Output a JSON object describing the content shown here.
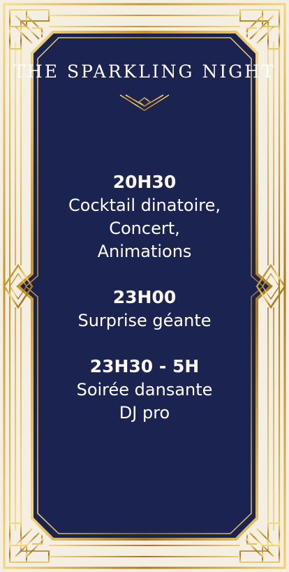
{
  "poster": {
    "title": "THE SPARKLING NIGHT",
    "colors": {
      "navy": "#1b2451",
      "gold": "#d4a93b",
      "gold_light": "#f6e08a",
      "gold_dark": "#9a6f17"
    },
    "ornament": "art-deco-gold-frame",
    "events": [
      {
        "time": "20H30",
        "lines": [
          "Cocktail dinatoire,",
          "Concert,",
          "Animations"
        ]
      },
      {
        "time": "23H00",
        "lines": [
          "Surprise géante"
        ]
      },
      {
        "time": "23H30 - 5H",
        "lines": [
          "Soirée dansante",
          "DJ pro"
        ]
      }
    ]
  }
}
